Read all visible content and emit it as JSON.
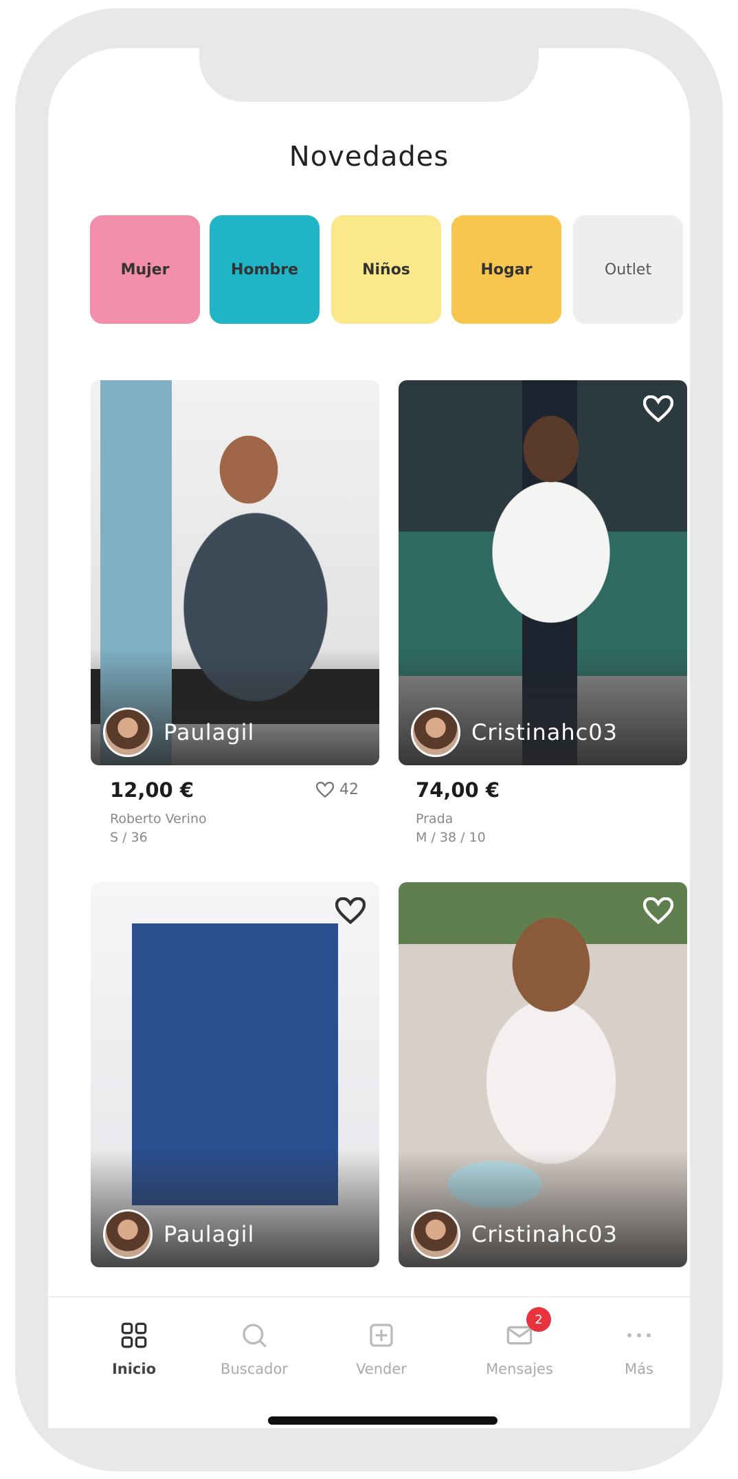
{
  "header": {
    "title": "Novedades"
  },
  "categories": [
    {
      "label": "Mujer",
      "color": "#f48fab"
    },
    {
      "label": "Hombre",
      "color": "#1fb4c6"
    },
    {
      "label": "Niños",
      "color": "#fbe88a"
    },
    {
      "label": "Hogar",
      "color": "#f8c54e"
    },
    {
      "label": "Outlet",
      "color": "#eeeeee"
    }
  ],
  "products": [
    {
      "seller": "Paulagil",
      "price": "12,00 €",
      "brand": "Roberto Verino",
      "size": "S / 36",
      "likes": "42"
    },
    {
      "seller": "Cristinahc03",
      "price": "74,00 €",
      "brand": "Prada",
      "size": "M / 38 / 10"
    },
    {
      "seller": "Paulagil"
    },
    {
      "seller": "Cristinahc03"
    }
  ],
  "tabbar": {
    "items": [
      {
        "label": "Inicio",
        "icon": "grid-icon",
        "active": true
      },
      {
        "label": "Buscador",
        "icon": "search-icon"
      },
      {
        "label": "Vender",
        "icon": "sell-icon"
      },
      {
        "label": "Mensajes",
        "icon": "mail-icon",
        "badge": "2"
      },
      {
        "label": "Más",
        "icon": "more-icon"
      }
    ]
  }
}
